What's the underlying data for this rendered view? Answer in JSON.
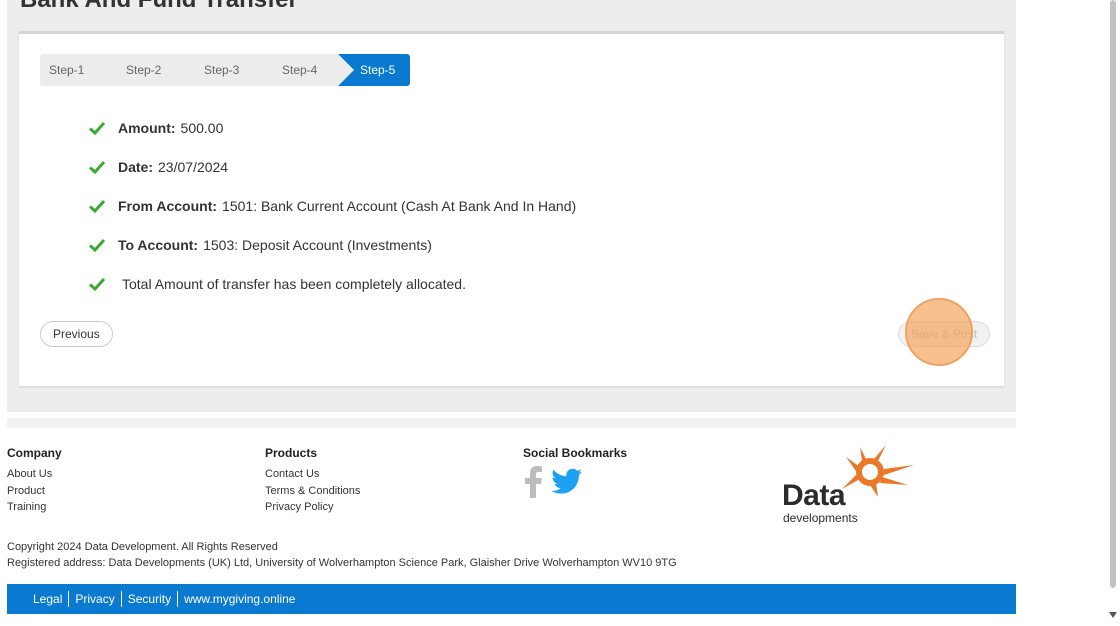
{
  "page": {
    "title": "Bank And Fund Transfer"
  },
  "stepper": {
    "steps": [
      "Step-1",
      "Step-2",
      "Step-3",
      "Step-4",
      "Step-5"
    ],
    "active_index": 4
  },
  "summary": {
    "amount": {
      "label": "Amount:",
      "value": "500.00"
    },
    "date": {
      "label": "Date:",
      "value": "23/07/2024"
    },
    "from_account": {
      "label": "From Account:",
      "value": "1501: Bank Current Account (Cash At Bank And In Hand)"
    },
    "to_account": {
      "label": "To Account:",
      "value": "1503: Deposit Account (Investments)"
    },
    "allocation_note": "Total Amount of transfer has been completely allocated."
  },
  "actions": {
    "previous_label": "Previous",
    "save_post_label": "Save & Post"
  },
  "footer": {
    "company": {
      "heading": "Company",
      "links": [
        "About Us",
        "Product",
        "Training"
      ]
    },
    "products": {
      "heading": "Products",
      "links": [
        "Contact Us",
        "Terms & Conditions",
        "Privacy Policy"
      ]
    },
    "social": {
      "heading": "Social Bookmarks",
      "icons": [
        "facebook-icon",
        "twitter-icon"
      ]
    },
    "logo": {
      "word": "Data",
      "sub": "developments"
    },
    "copyright": "Copyright 2024 Data Development. All Rights Reserved",
    "address": "Registered address: Data Developments (UK) Ltd, University of Wolverhampton Science Park, Glaisher Drive Wolverhampton WV10 9TG",
    "bottom_links": [
      "Legal",
      "Privacy",
      "Security",
      "www.mygiving.online"
    ]
  },
  "colors": {
    "accent": "#0a7ad1",
    "check": "#3aaa35",
    "logo_orange": "#e9782a",
    "logo_text": "#2b2b2b"
  }
}
